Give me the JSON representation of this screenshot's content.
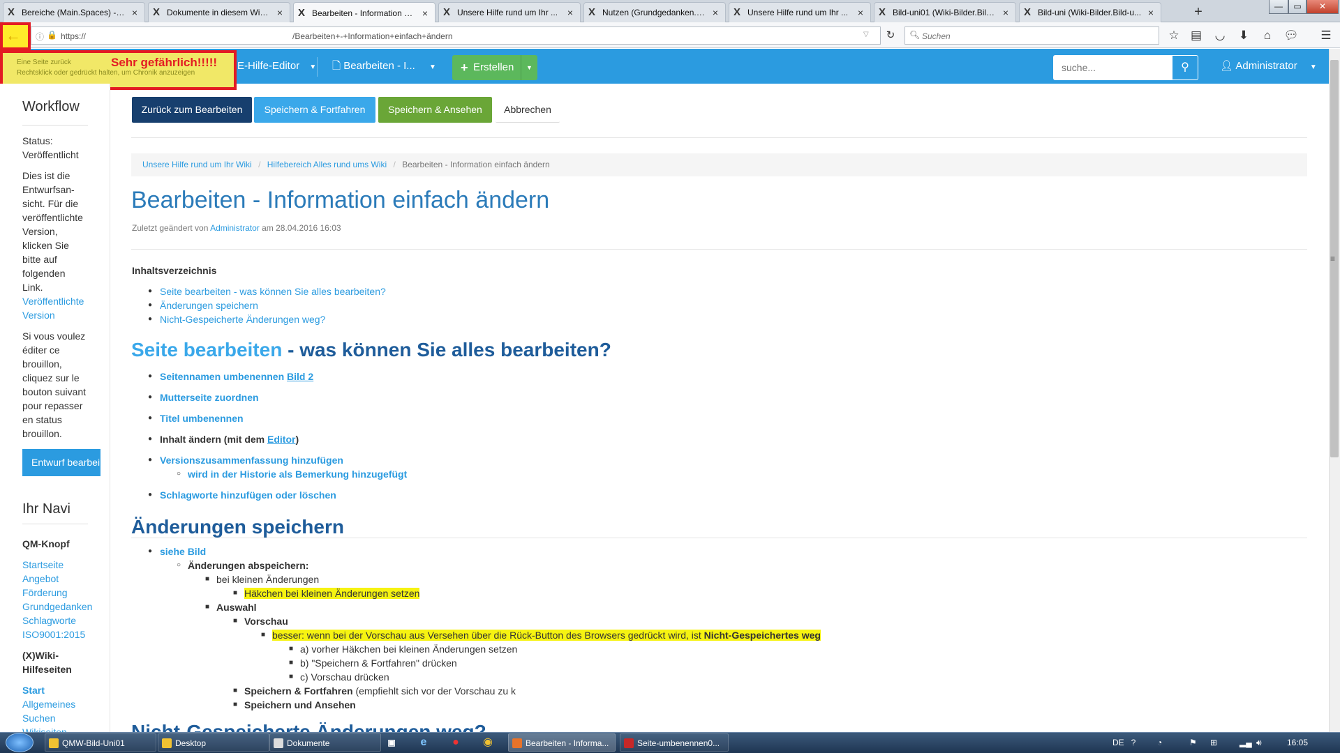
{
  "browser": {
    "tabs": [
      {
        "label": "Bereiche (Main.Spaces) - X..."
      },
      {
        "label": "Dokumente in diesem Wiki..."
      },
      {
        "label": "Bearbeiten - Information ei...",
        "active": true
      },
      {
        "label": "Unsere Hilfe rund um Ihr ..."
      },
      {
        "label": "Nutzen (Grundgedanken.N..."
      },
      {
        "label": "Unsere Hilfe rund um Ihr ..."
      },
      {
        "label": "Bild-uni01 (Wiki-Bilder.Bild..."
      },
      {
        "label": "Bild-uni (Wiki-Bilder.Bild-u..."
      }
    ],
    "url_scheme": "https://",
    "url_path": "/Bearbeiten+-+Information+einfach+ändern",
    "search_placeholder": "Suchen"
  },
  "tooltip": {
    "line1": "Eine Seite zurück",
    "line2": "Rechtsklick oder gedrückt halten, um Chronik anzuzeigen",
    "warning": "Sehr gefährlich!!!!!"
  },
  "header": {
    "editor_menu": "E-Hilfe-Editor",
    "page_menu": "Bearbeiten - I...",
    "create_button": "Erstellen",
    "search_placeholder": "suche...",
    "user": "Administrator"
  },
  "sidebar": {
    "workflow_title": "Workflow",
    "status_lines": [
      "Status:",
      "Veröffentlicht"
    ],
    "draft_text": [
      "Dies ist die",
      "Entwurfsan-",
      "sicht. Für die",
      "veröffentlichte",
      "Version,",
      "klicken Sie",
      "bitte auf",
      "folgenden",
      "Link."
    ],
    "published_link": [
      "Veröffentlichte",
      "Version"
    ],
    "french_text": [
      "Si vous voulez",
      "éditer ce",
      "brouillon,",
      "cliquez sur le",
      "bouton suivant",
      "pour repasser",
      "en status",
      "brouillon."
    ],
    "draft_button": "Entwurf bearbei",
    "nav_title": "Ihr Navi",
    "qm_title": "QM-Knopf",
    "qm_links": [
      "Startseite",
      "Angebot",
      "Förderung",
      "Grundgedanken",
      "Schlagworte",
      "ISO9001:2015"
    ],
    "xwiki_title": [
      "(X)Wiki-",
      "Hilfeseiten"
    ],
    "xwiki_links": [
      "Start",
      "Allgemeines",
      "Suchen",
      "Wikiseiten"
    ]
  },
  "actions": {
    "back_to_edit": "Zurück zum Bearbeiten",
    "save_continue": "Speichern & Fortfahren",
    "save_view": "Speichern & Ansehen",
    "cancel": "Abbrechen"
  },
  "breadcrumb": [
    "Unsere Hilfe rund um Ihr Wiki",
    "Hilfebereich Alles rund ums Wiki",
    "Bearbeiten - Information einfach ändern"
  ],
  "page": {
    "title": "Bearbeiten - Information einfach ändern",
    "meta_prefix": "Zuletzt geändert von",
    "meta_user": "Administrator",
    "meta_suffix": "am 28.04.2016 16:03",
    "toc_title": "Inhaltsverzeichnis",
    "toc": [
      "Seite bearbeiten - was können Sie alles bearbeiten?",
      "Änderungen speichern",
      "Nicht-Gespeicherte Änderungen weg?"
    ],
    "h_edit_a": "Seite bearbeiten",
    "h_edit_b": "- was können Sie alles bearbeiten?",
    "edit_items": {
      "rename": "Seitennamen umbenennen",
      "rename_img": "Bild 2",
      "parent": "Mutterseite zuordnen",
      "title": "Titel umbenennen",
      "content_a": "Inhalt ändern (mit dem",
      "content_link": "Editor",
      "content_b": ")",
      "version": "Versionszusammenfassung hinzufügen",
      "version_sub": "wird in der Historie als Bemerkung hinzugefügt",
      "tags": "Schlagworte hinzufügen oder löschen"
    },
    "h_save": "Änderungen speichern",
    "save_items": {
      "see": "siehe Bild",
      "store": "Änderungen abspeichern:",
      "small": "bei kleinen Änderungen",
      "small_check": "Häkchen bei kleinen Änderungen setzen",
      "choice": "Auswahl",
      "preview": "Vorschau",
      "better_a": "besser: wenn bei der Vorschau aus Versehen über die Rück-Button des Browsers gedrückt wird, ist",
      "better_b": "Nicht-Gespeichertes weg",
      "step_a": "a) vorher Häkchen bei kleinen Änderungen setzen",
      "step_b": "b) \"Speichern & Fortfahren\" drücken",
      "step_c": "c) Vorschau drücken",
      "save_continue_a": "Speichern & Fortfahren",
      "save_continue_b": "(empfiehlt sich vor der Vorschau zu k",
      "save_view": "Speichern und Ansehen"
    },
    "h_next_partial": "Nicht-Gespeicherte Änderungen weg?"
  },
  "taskbar": {
    "items": [
      "QMW-Bild-Uni01",
      "Desktop",
      "Dokumente",
      "Bearbeiten - Informa...",
      "Seite-umbenennen0..."
    ],
    "lang": "DE",
    "time": "16:05"
  },
  "colors": {
    "accent": "#2b9be0",
    "dark_button": "#173f6e",
    "green": "#6aa637",
    "highlight": "#f6f311",
    "warning_red": "#e31b23"
  }
}
